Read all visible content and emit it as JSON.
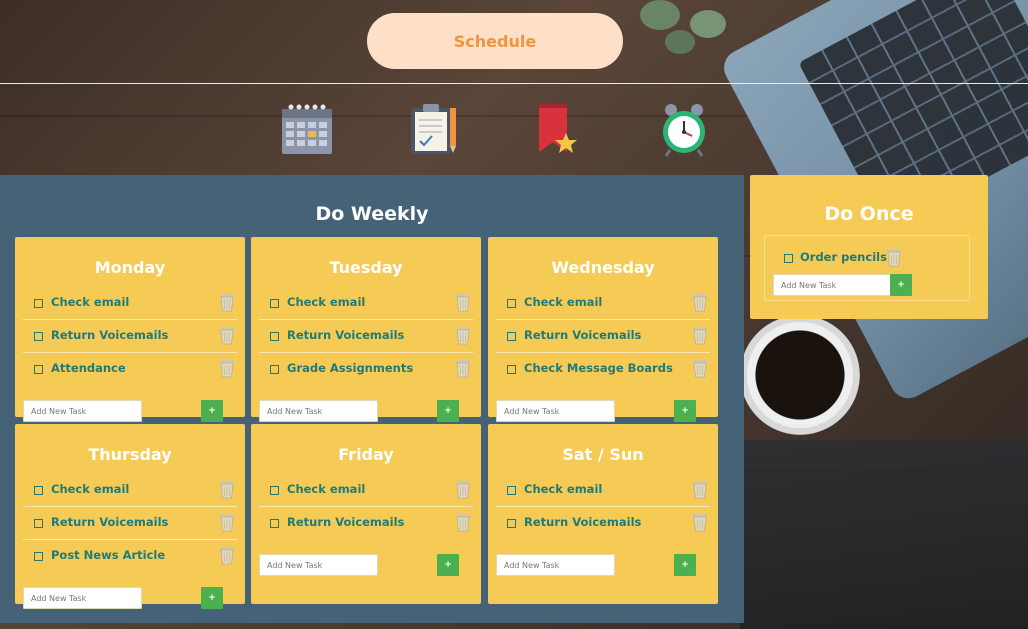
{
  "header": {
    "schedule_label": "Schedule"
  },
  "nav_icons": [
    "calendar-icon",
    "clipboard-icon",
    "bookmark-star-icon",
    "alarm-clock-icon"
  ],
  "colors": {
    "accent": "#f0953e",
    "panel_blue": "#456277",
    "card_yellow": "#f5cb55",
    "task_text": "#1f7a7a",
    "add_button": "#4cb050"
  },
  "weekly": {
    "title": "Do Weekly",
    "add_placeholder": "Add New Task",
    "add_button_label": "+",
    "days": [
      {
        "name": "Monday",
        "tasks": [
          "Check email",
          "Return Voicemails",
          "Attendance"
        ]
      },
      {
        "name": "Tuesday",
        "tasks": [
          "Check email",
          "Return Voicemails",
          "Grade Assignments"
        ]
      },
      {
        "name": "Wednesday",
        "tasks": [
          "Check email",
          "Return Voicemails",
          "Check Message Boards"
        ]
      },
      {
        "name": "Thursday",
        "tasks": [
          "Check email",
          "Return Voicemails",
          "Post News Article"
        ]
      },
      {
        "name": "Friday",
        "tasks": [
          "Check email",
          "Return Voicemails"
        ]
      },
      {
        "name": "Sat / Sun",
        "tasks": [
          "Check email",
          "Return Voicemails"
        ]
      }
    ]
  },
  "once": {
    "title": "Do Once",
    "tasks": [
      "Order pencils"
    ],
    "add_placeholder": "Add New Task",
    "add_button_label": "+"
  }
}
